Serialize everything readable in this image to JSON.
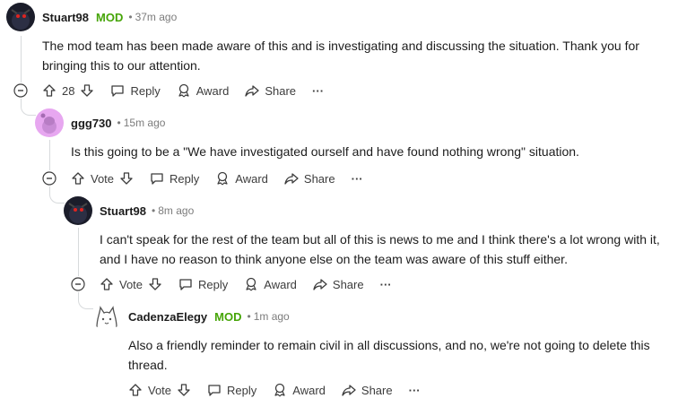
{
  "comments": [
    {
      "author": "Stuart98",
      "mod_badge": "MOD",
      "separator": "•",
      "time": "37m ago",
      "text": "The mod team has been made aware of this and is investigating and discussing the situation. Thank you for bringing this to our attention.",
      "score": "28",
      "reply_label": "Reply",
      "award_label": "Award",
      "share_label": "Share",
      "more_label": "···"
    },
    {
      "author": "ggg730",
      "separator": "•",
      "time": "15m ago",
      "text": "Is this going to be a \"We have investigated ourself and have found nothing wrong\" situation.",
      "score": "Vote",
      "reply_label": "Reply",
      "award_label": "Award",
      "share_label": "Share",
      "more_label": "···"
    },
    {
      "author": "Stuart98",
      "separator": "•",
      "time": "8m ago",
      "text": "I can't speak for the rest of the team but all of this is news to me and I think there's a lot wrong with it, and I have no reason to think anyone else on the team was aware of this stuff either.",
      "score": "Vote",
      "reply_label": "Reply",
      "award_label": "Award",
      "share_label": "Share",
      "more_label": "···"
    },
    {
      "author": "CadenzaElegy",
      "mod_badge": "MOD",
      "separator": "•",
      "time": "1m ago",
      "text": "Also a friendly reminder to remain civil in all discussions, and no, we're not going to delete this thread.",
      "score": "Vote",
      "reply_label": "Reply",
      "award_label": "Award",
      "share_label": "Share",
      "more_label": "···"
    }
  ],
  "colors": {
    "mod": "#46a508",
    "meta": "#7c7c7c",
    "line": "#d7dadc"
  },
  "icons": [
    "collapse-icon",
    "upvote-icon",
    "downvote-icon",
    "reply-icon",
    "award-icon",
    "share-icon",
    "more-icon"
  ]
}
